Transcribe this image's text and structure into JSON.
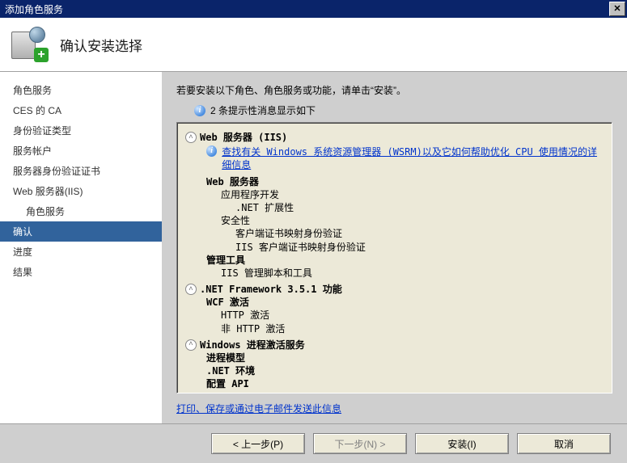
{
  "window": {
    "title": "添加角色服务"
  },
  "header": {
    "title": "确认安装选择"
  },
  "sidebar": {
    "items": [
      {
        "label": "角色服务",
        "indent": false
      },
      {
        "label": "CES 的 CA",
        "indent": false
      },
      {
        "label": "身份验证类型",
        "indent": false
      },
      {
        "label": "服务帐户",
        "indent": false
      },
      {
        "label": "服务器身份验证证书",
        "indent": false
      },
      {
        "label": "Web 服务器(IIS)",
        "indent": false
      },
      {
        "label": "角色服务",
        "indent": true
      },
      {
        "label": "确认",
        "indent": false,
        "selected": true
      },
      {
        "label": "进度",
        "indent": false
      },
      {
        "label": "结果",
        "indent": false
      }
    ]
  },
  "main": {
    "intro": "若要安装以下角色、角色服务或功能，请单击“安装”。",
    "info_prefix": "2 条提示性消息显示如下",
    "group_iis_title": "Web 服务器 (IIS)",
    "iis_hint": "查找有关 Windows 系统资源管理器 (WSRM)以及它如何帮助优化 CPU 使用情况的详细信息",
    "webserver_label": "Web 服务器",
    "app_dev_label": "应用程序开发",
    "net_ext_label": ".NET 扩展性",
    "security_label": "安全性",
    "client_cert_map": "客户端证书映射身份验证",
    "iis_client_cert_map": "IIS 客户端证书映射身份验证",
    "mgmt_tools_label": "管理工具",
    "mgmt_scripts_label": "IIS 管理脚本和工具",
    "group_netfx_title": ".NET Framework 3.5.1 功能",
    "wcf_label": "WCF 激活",
    "http_act": "HTTP 激活",
    "nonhttp_act": "非 HTTP 激活",
    "group_was_title": "Windows 进程激活服务",
    "proc_model": "进程模型",
    "net_env": ".NET 环境",
    "config_api": "配置 API",
    "link_print": "打印、保存或通过电子邮件发送此信息"
  },
  "footer": {
    "prev": "< 上一步(P)",
    "next": "下一步(N) >",
    "install": "安装(I)",
    "cancel": "取消"
  }
}
